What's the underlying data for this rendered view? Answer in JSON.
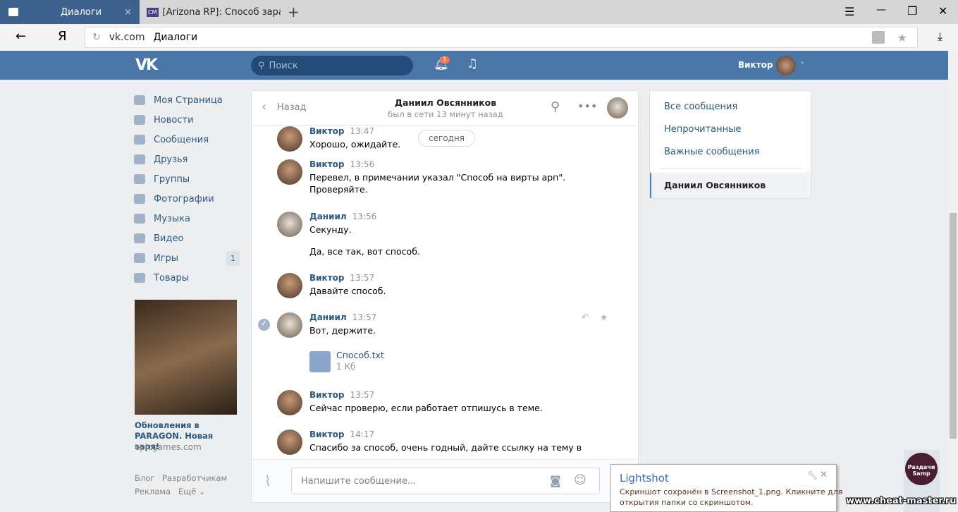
{
  "browser": {
    "tabs": [
      {
        "label": "Диалоги",
        "close": "×"
      },
      {
        "label": "[Arizona RP]: Способ зарабо",
        "favicon": "CM"
      }
    ],
    "new_tab": "+",
    "back": "←",
    "yandex": "Я",
    "url_domain": "vk.com",
    "url_title": "Диалоги",
    "download": "⤓",
    "menu": "☰",
    "minimize": "—",
    "restore": "❐",
    "close": "✕"
  },
  "header": {
    "search_placeholder": "Поиск",
    "notif_count": "1",
    "user_name": "Виктор"
  },
  "sidebar": {
    "items": [
      {
        "label": "Моя Страница"
      },
      {
        "label": "Новости"
      },
      {
        "label": "Сообщения"
      },
      {
        "label": "Друзья"
      },
      {
        "label": "Группы"
      },
      {
        "label": "Фотографии"
      },
      {
        "label": "Музыка"
      },
      {
        "label": "Видео"
      },
      {
        "label": "Игры",
        "badge": "1"
      },
      {
        "label": "Товары"
      }
    ],
    "ad": {
      "title": "Обновления в PARAGON. Новая заря!",
      "domain": "epicgames.com"
    },
    "footer": {
      "blog": "Блог",
      "dev": "Разработчикам",
      "ads": "Реклама",
      "more": "Ещё ⌄"
    }
  },
  "chat": {
    "back": "Назад",
    "name": "Даниил Овсянников",
    "status": "был в сети 13 минут назад",
    "date_pill": "сегодня",
    "messages": [
      {
        "author": "Виктор",
        "time": "13:47",
        "lines": [
          "Хорошо, ожидайте."
        ]
      },
      {
        "author": "Виктор",
        "time": "13:56",
        "lines": [
          "Перевел, в примечании указал \"Способ на вирты арп\".",
          "Проверяйте."
        ]
      },
      {
        "author": "Даниил",
        "time": "13:56",
        "lines": [
          "Секунду.",
          "Да, все так, вот способ."
        ]
      },
      {
        "author": "Виктор",
        "time": "13:57",
        "lines": [
          "Давайте способ."
        ]
      },
      {
        "author": "Даниил",
        "time": "13:57",
        "lines": [
          "Вот, держите."
        ],
        "file": {
          "name": "Способ.txt",
          "size": "1 Кб"
        }
      },
      {
        "author": "Виктор",
        "time": "13:57",
        "lines": [
          "Сейчас проверю, если работает отпишусь в теме."
        ]
      },
      {
        "author": "Виктор",
        "time": "14:17",
        "lines": [
          "Спасибо за способ, очень годный, дайте ссылку на тему в"
        ]
      }
    ],
    "input_placeholder": "Напишите сообщение..."
  },
  "right_panel": {
    "items": [
      "Все сообщения",
      "Непрочитанные",
      "Важные сообщения"
    ],
    "active": "Даниил Овсянников"
  },
  "lightshot": {
    "title": "Lightshot",
    "text1": "Скриншот сохранён в Screenshot_1.png. Кликните для",
    "text2": "открытия папки со скриншотом."
  },
  "watermark": "www.cheat-master.ru",
  "corner_logo": "Раздачи Samp"
}
